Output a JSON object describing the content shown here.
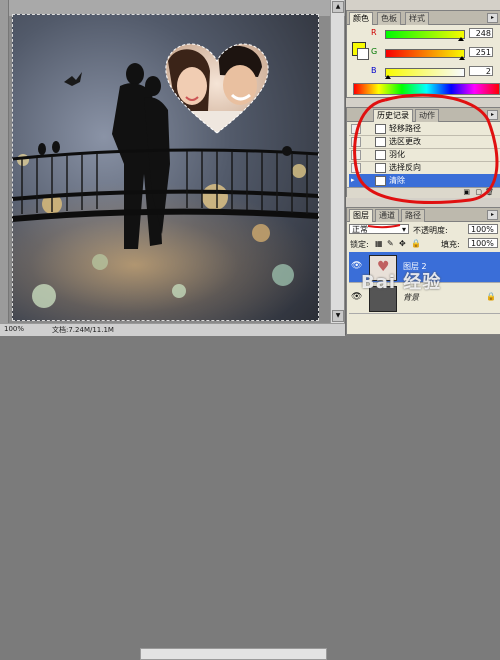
{
  "status": {
    "doc": "文档:7.24M/11.1M",
    "zoom": "100%"
  },
  "color_panel": {
    "tabs": [
      "颜色",
      "色板",
      "样式"
    ],
    "rows": [
      {
        "label": "R",
        "value": "248",
        "pct": 0.97
      },
      {
        "label": "G",
        "value": "251",
        "pct": 0.98
      },
      {
        "label": "B",
        "value": "2",
        "pct": 0.01
      }
    ],
    "fg_color": "#f8fb02"
  },
  "history_panel": {
    "tabs": [
      "历史记录",
      "动作"
    ],
    "items": [
      {
        "label": "轻移路径"
      },
      {
        "label": "选区更改"
      },
      {
        "label": "羽化"
      },
      {
        "label": "选择反向"
      },
      {
        "label": "清除"
      }
    ],
    "active_item": "清除"
  },
  "layers_panel": {
    "tabs": [
      "图层",
      "通道",
      "路径"
    ],
    "blend_mode": "正常",
    "opacity_label": "不透明度:",
    "opacity": "100%",
    "lock_label": "锁定:",
    "fill_label": "填充:",
    "fill": "100%",
    "layers": [
      {
        "name": "图层 2",
        "selected": true
      },
      {
        "name": "背景",
        "selected": false
      }
    ]
  },
  "watermark": "Bai 经验"
}
